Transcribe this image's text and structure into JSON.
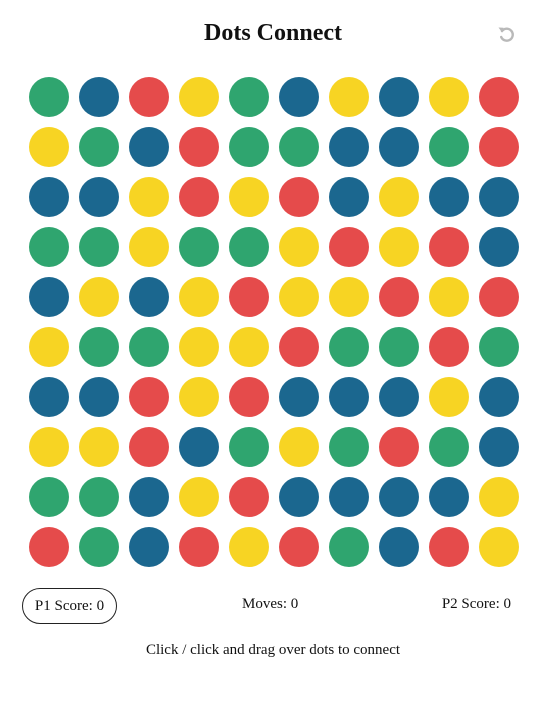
{
  "title": "Dots Connect",
  "controls": {
    "undo_icon": "undo-arrow-icon"
  },
  "colors": {
    "G": "#2fa56f",
    "B": "#1b678f",
    "R": "#e54b4b",
    "Y": "#f7d423",
    "undo_icon": "#b9b9b9"
  },
  "board": {
    "rows": [
      [
        "G",
        "B",
        "R",
        "Y",
        "G",
        "B",
        "Y",
        "B",
        "Y",
        "R"
      ],
      [
        "Y",
        "G",
        "B",
        "R",
        "G",
        "G",
        "B",
        "B",
        "G",
        "R"
      ],
      [
        "B",
        "B",
        "Y",
        "R",
        "Y",
        "R",
        "B",
        "Y",
        "B",
        "B"
      ],
      [
        "G",
        "G",
        "Y",
        "G",
        "G",
        "Y",
        "R",
        "Y",
        "R",
        "B"
      ],
      [
        "B",
        "Y",
        "B",
        "Y",
        "R",
        "Y",
        "Y",
        "R",
        "Y",
        "R"
      ],
      [
        "Y",
        "G",
        "G",
        "Y",
        "Y",
        "R",
        "G",
        "G",
        "R",
        "G"
      ],
      [
        "B",
        "B",
        "R",
        "Y",
        "R",
        "B",
        "B",
        "B",
        "Y",
        "B"
      ],
      [
        "Y",
        "Y",
        "R",
        "B",
        "G",
        "Y",
        "G",
        "R",
        "G",
        "B"
      ],
      [
        "G",
        "G",
        "B",
        "Y",
        "R",
        "B",
        "B",
        "B",
        "B",
        "Y"
      ],
      [
        "R",
        "G",
        "B",
        "R",
        "Y",
        "R",
        "G",
        "B",
        "R",
        "Y"
      ]
    ]
  },
  "scores": {
    "p1": "P1 Score: 0",
    "moves": "Moves: 0",
    "p2": "P2 Score: 0"
  },
  "hint": "Click / click and drag over dots to connect"
}
